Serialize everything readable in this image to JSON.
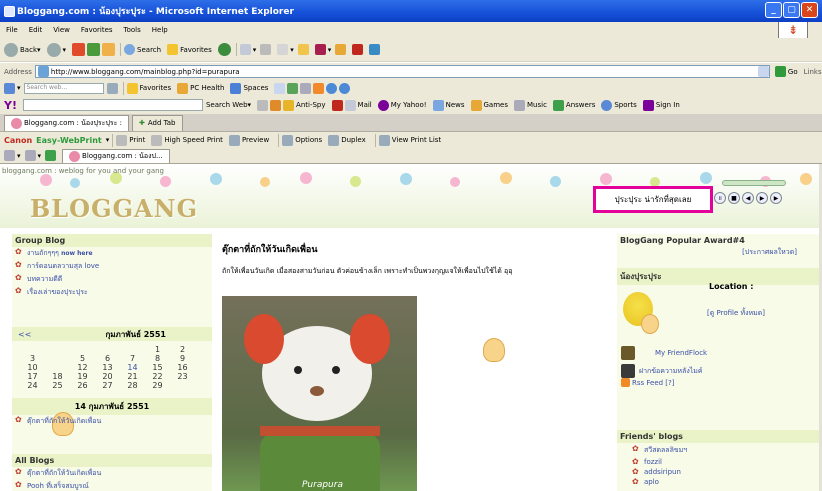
{
  "window": {
    "title": "Bloggang.com : น้องปุระปุระ - Microsoft Internet Explorer"
  },
  "menu": [
    "File",
    "Edit",
    "View",
    "Favorites",
    "Tools",
    "Help"
  ],
  "toolbar": {
    "back": "Back",
    "search": "Search",
    "favorites": "Favorites"
  },
  "address": {
    "label": "Address",
    "url": "http://www.bloggang.com/mainblog.php?id=purapura",
    "go": "Go",
    "links": "Links"
  },
  "bar1": {
    "search_placeholder": "Search web...",
    "favorites": "Favorites",
    "pc_health": "PC Health",
    "spaces": "Spaces"
  },
  "bar2": {
    "items": [
      "Search Web",
      "Anti-Spy",
      "Mail",
      "My Yahoo!",
      "News",
      "Games",
      "Music",
      "Answers",
      "Sports",
      "Sign In"
    ]
  },
  "tabs": {
    "active": "Bloggang.com : น้องปุระปุระ :",
    "add": "Add Tab"
  },
  "canon": {
    "brand": "Canon",
    "product": "Easy-WebPrint",
    "items": [
      "Print",
      "High Speed Print",
      "Preview",
      "Options",
      "Duplex",
      "View Print List"
    ]
  },
  "tab2": {
    "label": "Bloggang.com : น้องป..."
  },
  "blog": {
    "tagline": "bloggang.com : weblog for you and your gang",
    "logo": "BLOGGANG",
    "name": "ปุระปุระ น่ารักที่สุดเลย",
    "left": {
      "group_title": "Group Blog",
      "groups": [
        "งานถักๆๆๆ",
        "การ์ดอนดลวามสุล love",
        "บทความดีดี",
        "เรื่องเล่าของปุระปุระ"
      ],
      "now_here": "now here",
      "cal_prev": "<<",
      "cal_month": "กุมภาพันธ์ 2551",
      "cal_days": [
        "",
        "",
        "",
        "",
        "",
        "1",
        "2",
        "3",
        "",
        "5",
        "6",
        "7",
        "8",
        "9",
        "10",
        "",
        "12",
        "13",
        "14",
        "15",
        "16",
        "17",
        "18",
        "19",
        "20",
        "21",
        "22",
        "23",
        "24",
        "25",
        "26",
        "27",
        "28",
        "29",
        ""
      ],
      "date_title": "14 กุมภาพันธ์ 2551",
      "date_link": "ตุ๊กตาที่ถักให้วันเกิดเพื่อน",
      "all_title": "All Blogs",
      "all_blogs": [
        "ตุ๊กตาที่ถักให้วันเกิดเพื่อน",
        "Pooh ที่เสร็จสมบูรณ์"
      ]
    },
    "post": {
      "title": "ตุ๊กตาที่ถักให้วันเกิดเพื่อน",
      "body": "ถักให้เพื่อนวันเกิด เมื่อสองสามวันก่อน ตัวค่อนข้างเล็ก เพราะทำเป็นพวงกุญแจให้เพื่อนไปใช้ได้ อุอุ",
      "watermark": "Purapura"
    },
    "right": {
      "award_title": "BlogGang Popular Award#4",
      "award_link": "[ประกาศผลใหวด]",
      "owner_title": "น้องปุระปุระ",
      "location": "Location :",
      "profile_link": "[ดู Profile ทั้งหมด]",
      "friendflock": "My FriendFlock",
      "guestbook": "ฝากข้อความหลังไมค์",
      "rss": "Rss Feed [?]",
      "friends_title": "Friends' blogs",
      "friends": [
        "สวีสดลลลิขมฯ",
        "fozzil",
        "addsiripun",
        "aplo"
      ]
    }
  }
}
